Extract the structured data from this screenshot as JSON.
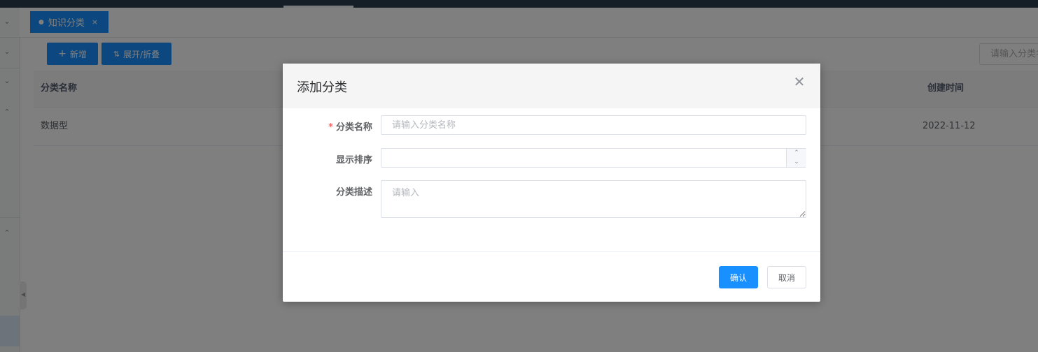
{
  "colors": {
    "primary": "#1890ff",
    "required": "#f56c6c",
    "topbar": "#2b3a4e"
  },
  "tabs": [
    {
      "label": "知识分类",
      "close": "×"
    }
  ],
  "toolbar": {
    "add_label": "新增",
    "expand_label": "展开/折叠"
  },
  "search": {
    "placeholder": "请输入分类名称"
  },
  "table": {
    "columns": [
      "分类名称",
      "创建时间"
    ],
    "rows": [
      {
        "name": "数据型",
        "created": "2022-11-12"
      }
    ]
  },
  "dialog": {
    "title": "添加分类",
    "fields": {
      "name": {
        "label": "分类名称",
        "required_mark": "*",
        "placeholder": "请输入分类名称",
        "value": ""
      },
      "sort": {
        "label": "显示排序",
        "value": ""
      },
      "desc": {
        "label": "分类描述",
        "placeholder": "请输入",
        "value": ""
      }
    },
    "confirm_label": "确认",
    "cancel_label": "取消"
  },
  "icons": {
    "close": "close-icon",
    "add": "plus-icon",
    "expand": "sort-icon"
  }
}
